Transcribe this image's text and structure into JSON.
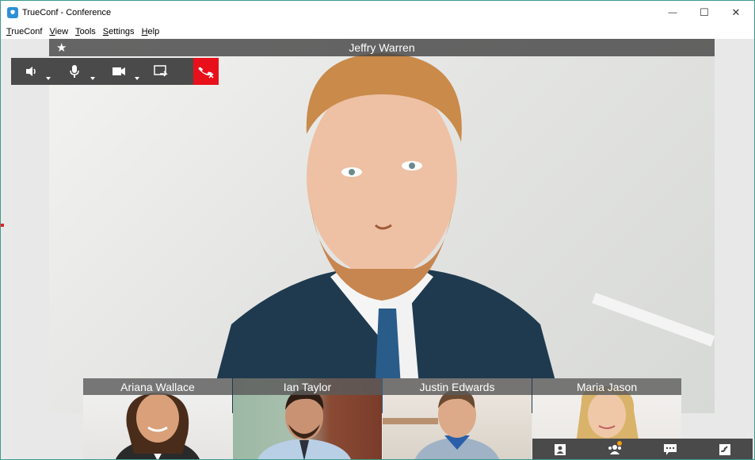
{
  "window": {
    "title": "TrueConf - Conference",
    "minimize_glyph": "—",
    "maximize_glyph": "☐",
    "close_glyph": "✕"
  },
  "menu": [
    {
      "label": "TrueConf",
      "underline": "T",
      "rest": "rueConf"
    },
    {
      "label": "View",
      "underline": "V",
      "rest": "iew"
    },
    {
      "label": "Tools",
      "underline": "T",
      "rest": "ools"
    },
    {
      "label": "Settings",
      "underline": "S",
      "rest": "ettings"
    },
    {
      "label": "Help",
      "underline": "H",
      "rest": "elp"
    }
  ],
  "conference": {
    "main_speaker": "Jeffry Warren",
    "star_glyph": "★",
    "toolbar": [
      {
        "icon": "speaker-icon",
        "has_dropdown": true
      },
      {
        "icon": "microphone-icon",
        "has_dropdown": true
      },
      {
        "icon": "camera-icon",
        "has_dropdown": true
      },
      {
        "icon": "share-screen-icon",
        "has_dropdown": false
      },
      {
        "icon": "hang-up-icon",
        "has_dropdown": false
      }
    ],
    "participants": [
      {
        "name": "Ariana Wallace"
      },
      {
        "name": "Ian Taylor"
      },
      {
        "name": "Justin Edwards"
      },
      {
        "name": "Maria Jason"
      }
    ],
    "bottom_bar": [
      {
        "icon": "contacts-icon"
      },
      {
        "icon": "participants-icon",
        "notification": true
      },
      {
        "icon": "chat-icon"
      },
      {
        "icon": "call-icon"
      }
    ]
  },
  "colors": {
    "hangup": "#e8101a",
    "toolbar": "#4a4a4a",
    "accent_border": "#3c9a8e",
    "notification": "#f39c12"
  }
}
